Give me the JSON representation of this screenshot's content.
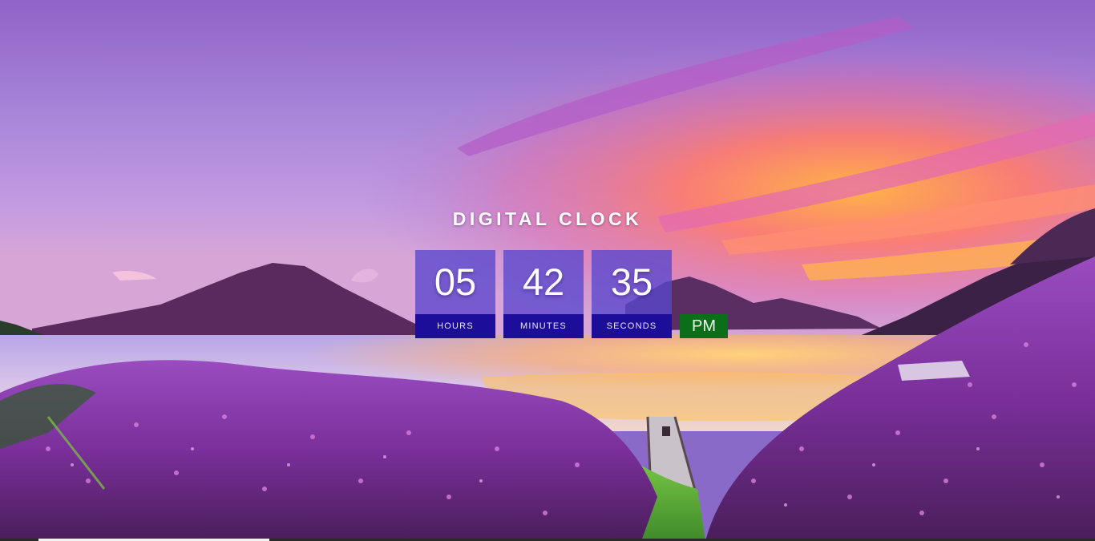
{
  "title": "DIGITAL CLOCK",
  "clock": {
    "hours": {
      "value": "05",
      "label": "HOURS"
    },
    "minutes": {
      "value": "42",
      "label": "MINUTES"
    },
    "seconds": {
      "value": "35",
      "label": "SECONDS"
    },
    "meridiem": "PM"
  },
  "colors": {
    "digit_box": "#5846cd",
    "label_box": "#1d0e9a",
    "meridiem_box": "#0b6f1a",
    "title_text": "#ffffff"
  },
  "background": {
    "icon": "landscape-photo"
  }
}
